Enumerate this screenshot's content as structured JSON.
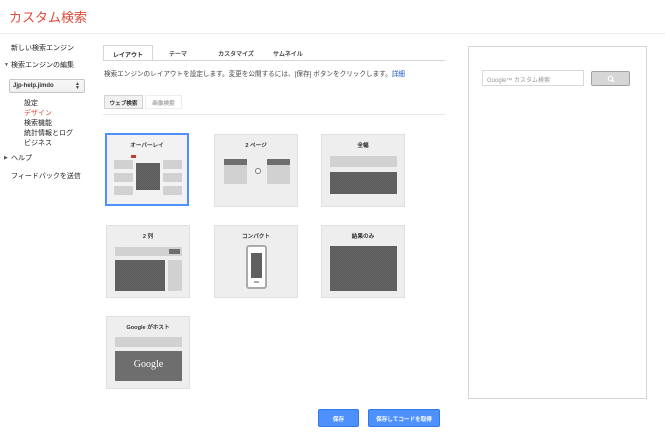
{
  "app": {
    "title": "カスタム検索"
  },
  "sidebar": {
    "new_engine": "新しい検索エンジン",
    "edit_engine": "検索エンジンの編集",
    "engine_select": "Jjp-help.jimdo",
    "sub_items": [
      "設定",
      "デザイン",
      "検索機能",
      "統計情報とログ",
      "ビジネス"
    ],
    "active_sub_item": "デザイン",
    "help": "ヘルプ",
    "feedback": "フィードバックを送信"
  },
  "tabs": [
    "レイアウト",
    "テーマ",
    "カスタマイズ",
    "サムネイル"
  ],
  "active_tab": "レイアウト",
  "description": "検索エンジンのレイアウトを設定します。変更を公開するには、[保存] ボタンをクリックします。",
  "details_link": "詳細",
  "subtabs": [
    "ウェブ検索",
    "画像検索"
  ],
  "active_subtab": "ウェブ検索",
  "layouts": [
    "オーバーレイ",
    "2 ページ",
    "全幅",
    "2 列",
    "コンパクト",
    "結果のみ",
    "Google がホスト"
  ],
  "selected_layout": "オーバーレイ",
  "google_hosted_logo": "Google",
  "preview": {
    "search_placeholder": "Google™ カスタム検索",
    "search_button_icon": "search-icon"
  },
  "buttons": {
    "save": "保存",
    "save_and_get_code": "保存してコードを取得"
  },
  "colors": {
    "title_red": "#dd4b39",
    "active_red": "#dd4b39",
    "link_blue": "#15c",
    "button_blue": "#4d90fe",
    "selected_border": "#4d90fe"
  }
}
